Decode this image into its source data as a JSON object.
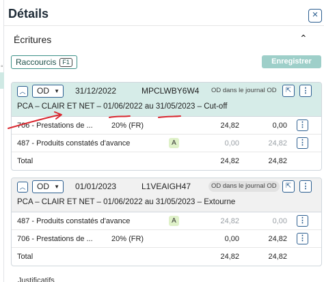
{
  "panel": {
    "title": "Détails",
    "close_icon": "×"
  },
  "section": {
    "title": "Écritures"
  },
  "toolbar": {
    "shortcuts_label": "Raccourcis",
    "shortcuts_key": "F1",
    "save_label": "Enregistrer"
  },
  "entries": [
    {
      "journal": "OD",
      "date": "31/12/2022",
      "reference": "MPCLWBY6W4",
      "badge": "OD dans le journal OD",
      "label": "PCA – CLAIR ET NET – 01/06/2022 au 31/05/2023 – Cut-off",
      "lines": [
        {
          "account": "706 - Prestations de ...",
          "vat": "20% (FR)",
          "debit": "24,82",
          "credit": "0,00"
        },
        {
          "account": "487 - Produits constatés d'avance",
          "vat": "A",
          "debit": "0,00",
          "credit": "24,82"
        }
      ],
      "total_label": "Total",
      "total_debit": "24,82",
      "total_credit": "24,82"
    },
    {
      "journal": "OD",
      "date": "01/01/2023",
      "reference": "L1VEAIGH47",
      "badge": "OD dans le journal OD",
      "label": "PCA – CLAIR ET NET – 01/06/2022 au 31/05/2023 – Extourne",
      "lines": [
        {
          "account": "487 - Produits constatés d'avance",
          "vat": "A",
          "debit": "24,82",
          "credit": "0,00"
        },
        {
          "account": "706 - Prestations de ...",
          "vat": "20% (FR)",
          "debit": "0,00",
          "credit": "24,82"
        }
      ],
      "total_label": "Total",
      "total_debit": "24,82",
      "total_credit": "24,82"
    }
  ],
  "footer": {
    "partial_text": "Justificatifs"
  },
  "colors": {
    "accent": "#2a5d8f",
    "teal_header": "#d6ece8",
    "save_disabled": "#9ecfc9",
    "annotation": "#d9262e"
  },
  "icons": {
    "collapse": "chevron-up-icon",
    "dropdown": "caret-down-icon",
    "external": "external-link-icon",
    "more": "vertical-dots-icon",
    "close": "close-icon"
  }
}
